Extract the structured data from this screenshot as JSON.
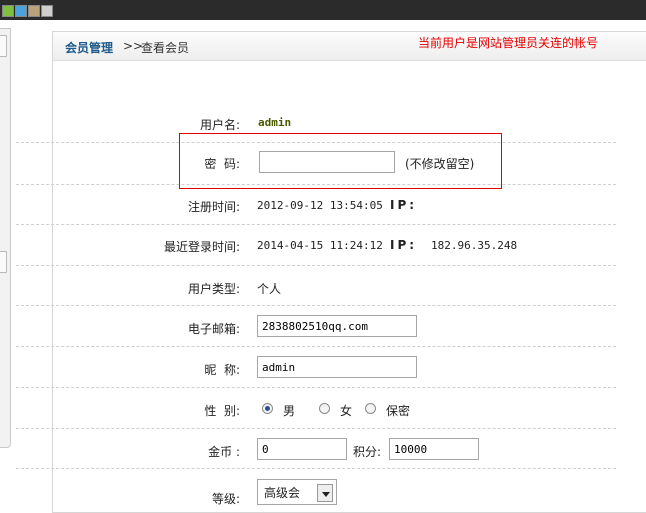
{
  "breadcrumb": {
    "main": "会员管理",
    "separator": ">>",
    "current": "查看会员"
  },
  "notice": "当前用户是网站管理员关连的帐号",
  "form": {
    "username": {
      "label": "用户名:",
      "value": "admin"
    },
    "password": {
      "label": "密  码:",
      "value": "",
      "hint": "(不修改留空)"
    },
    "register": {
      "label": "注册时间:",
      "value": "2012-09-12 13:54:05",
      "ip_label": "IP:",
      "ip_value": ""
    },
    "last_login": {
      "label": "最近登录时间:",
      "value": "2014-04-15 11:24:12",
      "ip_label": "IP:",
      "ip_value": "182.96.35.248"
    },
    "user_type": {
      "label": "用户类型:",
      "value": "个人"
    },
    "email": {
      "label": "电子邮箱:",
      "value": "2838802510qq.com"
    },
    "nickname": {
      "label": "昵  称:",
      "value": "admin"
    },
    "gender": {
      "label": "性  别:",
      "options": [
        "男",
        "女",
        "保密"
      ],
      "selected": "男"
    },
    "coins": {
      "label": "金币 :",
      "value": "0",
      "points_label": "积分:",
      "points_value": "10000"
    },
    "level": {
      "label": "等级:",
      "selected": "高级会"
    }
  },
  "colors": {
    "accent": "#1f5b8a",
    "notice": "#e60000",
    "highlight_box": "#e00000"
  }
}
